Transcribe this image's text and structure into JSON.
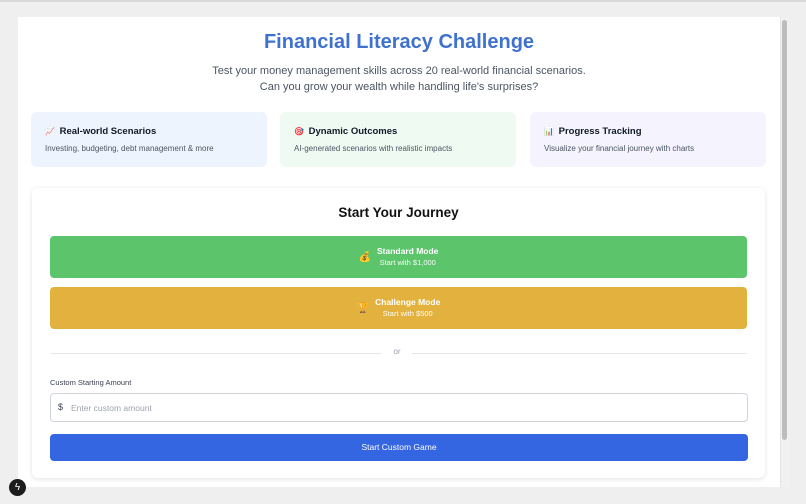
{
  "header": {
    "title": "Financial Literacy Challenge",
    "subtitle": "Test your money management skills across 20 real-world financial scenarios. Can you grow your wealth while handling life's surprises?"
  },
  "features": [
    {
      "icon": "📈",
      "icon_name": "chart-increasing-icon",
      "title": "Real-world Scenarios",
      "description": "Investing, budgeting, debt management & more",
      "bg": "#eef4fd"
    },
    {
      "icon": "🎯",
      "icon_name": "target-icon",
      "title": "Dynamic Outcomes",
      "description": "AI-generated scenarios with realistic impacts",
      "bg": "#effaf2"
    },
    {
      "icon": "📊",
      "icon_name": "bar-chart-icon",
      "title": "Progress Tracking",
      "description": "Visualize your financial journey with charts",
      "bg": "#f5f3fe"
    }
  ],
  "journey": {
    "title": "Start Your Journey",
    "standard": {
      "icon": "💰",
      "icon_name": "money-bag-icon",
      "label": "Standard Mode",
      "sub": "Start with $1,000",
      "color": "#5cc46b"
    },
    "challenge": {
      "icon": "🏆",
      "icon_name": "trophy-icon",
      "label": "Challenge Mode",
      "sub": "Start with $500",
      "color": "#e3b23e"
    },
    "divider": "or",
    "custom": {
      "label": "Custom Starting Amount",
      "currency": "$",
      "placeholder": "Enter custom amount",
      "value": "",
      "button": "Start Custom Game",
      "button_color": "#3366e0"
    }
  },
  "colors": {
    "title": "#3f72cf",
    "page_bg": "#efefef"
  },
  "devtools": {
    "icon_name": "lightning-icon",
    "glyph": "ϟ"
  }
}
